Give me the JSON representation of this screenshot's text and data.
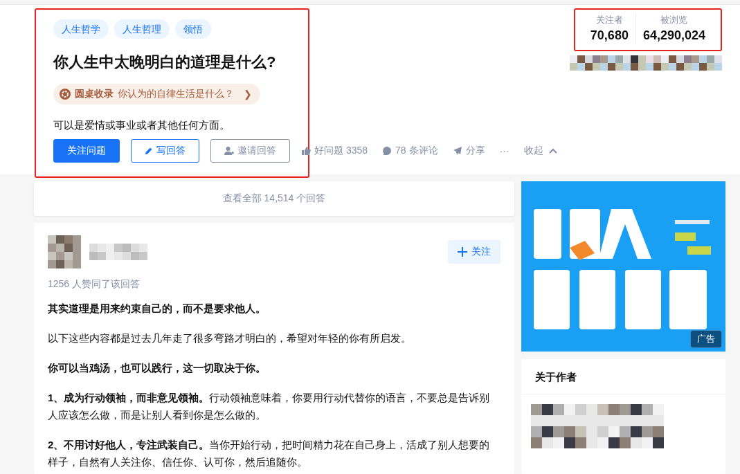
{
  "question": {
    "highlighted": true,
    "tags": [
      "人生哲学",
      "人生哲理",
      "领悟"
    ],
    "title": "你人生中太晚明白的道理是什么?",
    "roundtable": {
      "label": "圆桌收录",
      "title": "你认为的自律生活是什么？",
      "chevron": "❯"
    },
    "description": "可以是爱情或事业或者其他任何方面。",
    "buttons": [
      {
        "kind": "primary",
        "label": "关注问题"
      },
      {
        "kind": "write",
        "label": "写回答"
      },
      {
        "kind": "invite",
        "label": "邀请回答"
      }
    ],
    "actions": [
      {
        "kind": "like",
        "label": "好问题 3358"
      },
      {
        "kind": "comment",
        "label": "78 条评论"
      },
      {
        "kind": "share",
        "label": "分享"
      },
      {
        "kind": "more",
        "label": "···"
      },
      {
        "kind": "collapse",
        "label": "收起"
      }
    ]
  },
  "stats": {
    "highlighted": true,
    "items": [
      {
        "label": "关注者",
        "value": "70,680"
      },
      {
        "label": "被浏览",
        "value": "64,290,024"
      }
    ]
  },
  "view_all": "查看全部 14,514 个回答",
  "answer": {
    "follow_button": "关注",
    "votes": "1256 人赞同了该回答",
    "paragraphs": [
      {
        "bold": true,
        "text": "其实道理是用来约束自己的，而不是要求他人。"
      },
      {
        "bold": false,
        "text": "以下这些内容都是过去几年走了很多弯路才明白的，希望对年轻的你有所启发。"
      },
      {
        "bold": true,
        "text": "你可以当鸡汤，也可以践行，这一切取决于你。"
      },
      {
        "bold": false,
        "text": "**1、成为行动领袖，而非意见领袖。**行动领袖意味着，你要用行动代替你的语言，不要总是告诉别人应该怎么做，而是让别人看到你是怎么做的。"
      },
      {
        "bold": false,
        "text": "**2、不用讨好他人，专注武装自己。**当你开始行动，把时间精力花在自己身上，活成了别人想要的样子，自然有人关注你、信任你、认可你，然后追随你。"
      }
    ]
  },
  "ad": {
    "kind": "picture",
    "badge": "广告"
  },
  "author_card": {
    "title": "关于作者"
  }
}
